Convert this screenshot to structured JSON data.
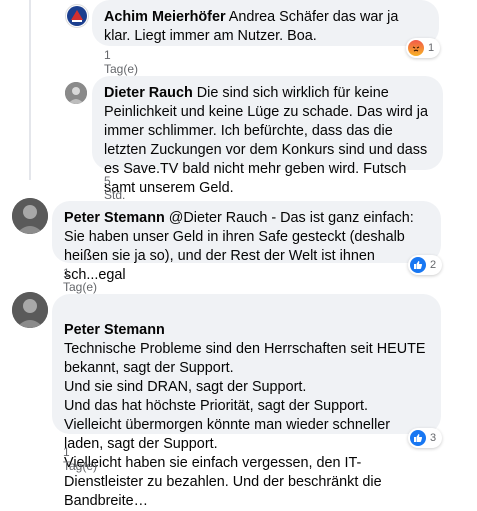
{
  "comments": [
    {
      "author": "Achim Meierhöfer",
      "text": "Andrea Schäfer das war ja klar. Liegt immer am Nutzer. Boa.",
      "time": "1 Tag(e)",
      "reaction": {
        "type": "angry-icon",
        "count": "1"
      }
    },
    {
      "author": "Dieter Rauch",
      "text": "Die sind sich wirklich für keine Peinlichkeit und keine Lüge zu schade. Das wird ja immer schlimmer. Ich befürchte, dass das die letzten Zuckungen vor dem Konkurs sind und dass es Save.TV bald nicht mehr geben wird. Futsch samt unserem Geld.",
      "time": "5 Std."
    },
    {
      "author": "Peter Stemann",
      "text": "@Dieter Rauch - Das ist ganz einfach: Sie haben unser Geld in ihren Safe gesteckt (deshalb heißen sie ja so), und der Rest der Welt ist ihnen sch...egal",
      "time": "1 Tag(e)",
      "reaction": {
        "type": "like-icon",
        "count": "2"
      }
    },
    {
      "author": "Peter Stemann",
      "text": "Technische Probleme sind den Herrschaften seit HEUTE bekannt, sagt der Support.\nUnd sie sind DRAN, sagt der Support.\nUnd das hat höchste Priorität, sagt der Support.\nVielleicht übermorgen könnte man wieder schneller laden, sagt der Support.\nVielleicht haben sie einfach vergessen, den IT-Dienstleister zu bezahlen. Und der beschränkt die Bandbreite…",
      "time": "1 Tag(e)",
      "reaction": {
        "type": "like-icon",
        "count": "3"
      }
    }
  ]
}
